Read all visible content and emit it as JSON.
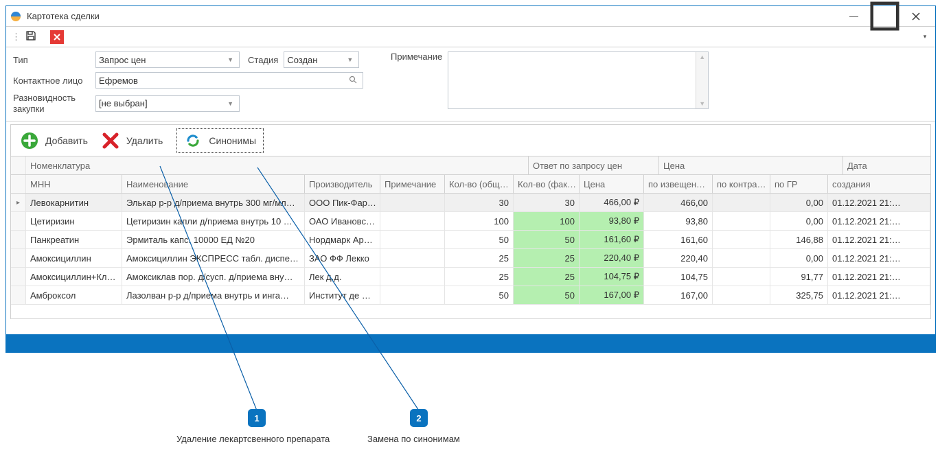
{
  "window": {
    "title": "Картотека сделки",
    "sys": {
      "minimize": "—",
      "maximize": "▭",
      "close": "✕"
    }
  },
  "form": {
    "type_label": "Тип",
    "type_value": "Запрос цен",
    "stage_label": "Стадия",
    "stage_value": "Создан",
    "note_label": "Примечание",
    "note_value": "",
    "contact_label": "Контактное лицо",
    "contact_value": "Ефремов",
    "variety_label": "Разновидность закупки",
    "variety_value": "[не выбран]"
  },
  "toolbar": {
    "add": "Добавить",
    "delete": "Удалить",
    "synonyms": "Синонимы"
  },
  "grid": {
    "group_nomenclature": "Номенклатура",
    "group_answer": "Ответ по запросу цен",
    "group_price": "Цена",
    "group_date": "Дата",
    "h_mnn": "МНН",
    "h_name": "Наименование",
    "h_prod": "Производитель",
    "h_note": "Примечание",
    "h_qtot": "Кол-во (общ…",
    "h_qfact": "Кол-во (фак…",
    "h_price": "Цена",
    "h_p1": "по извещен…",
    "h_p2": "по контра…",
    "h_p3": "по ГР",
    "h_date": "создания",
    "rows": [
      {
        "mnn": "Левокарнитин",
        "name": "Элькар р-р д/приема внутрь 300 мг/мл…",
        "prod": "ООО Пик-Фар…",
        "note": "",
        "qtot": "30",
        "qfact": "30",
        "price": "466,00 ₽",
        "p1": "466,00",
        "p2": "",
        "p3": "0,00",
        "date": "01.12.2021 21:…"
      },
      {
        "mnn": "Цетиризин",
        "name": "Цетиризин капли д/приема внутрь 10 …",
        "prod": "ОАО Ивановс…",
        "note": "",
        "qtot": "100",
        "qfact": "100",
        "price": "93,80 ₽",
        "p1": "93,80",
        "p2": "",
        "p3": "0,00",
        "date": "01.12.2021 21:…"
      },
      {
        "mnn": "Панкреатин",
        "name": "Эрмиталь капс. 10000 ЕД №20",
        "prod": "Нордмарк Ар…",
        "note": "",
        "qtot": "50",
        "qfact": "50",
        "price": "161,60 ₽",
        "p1": "161,60",
        "p2": "",
        "p3": "146,88",
        "date": "01.12.2021 21:…"
      },
      {
        "mnn": "Амоксициллин",
        "name": "Амоксициллин ЭКСПРЕСС табл. диспе…",
        "prod": "ЗАО ФФ Лекко",
        "note": "",
        "qtot": "25",
        "qfact": "25",
        "price": "220,40 ₽",
        "p1": "220,40",
        "p2": "",
        "p3": "0,00",
        "date": "01.12.2021 21:…"
      },
      {
        "mnn": "Амоксициллин+Кл…",
        "name": "Амоксиклав пор. д/сусп. д/приема вну…",
        "prod": "Лек д.д.",
        "note": "",
        "qtot": "25",
        "qfact": "25",
        "price": "104,75 ₽",
        "p1": "104,75",
        "p2": "",
        "p3": "91,77",
        "date": "01.12.2021 21:…"
      },
      {
        "mnn": "Амброксол",
        "name": "Лазолван р-р д/приема внутрь и инга…",
        "prod": "Институт де …",
        "note": "",
        "qtot": "50",
        "qfact": "50",
        "price": "167,00 ₽",
        "p1": "167,00",
        "p2": "",
        "p3": "325,75",
        "date": "01.12.2021 21:…"
      }
    ]
  },
  "callouts": {
    "c1_num": "1",
    "c1_text": "Удаление лекартсвенного препарата",
    "c2_num": "2",
    "c2_text": "Замена по синонимам"
  }
}
